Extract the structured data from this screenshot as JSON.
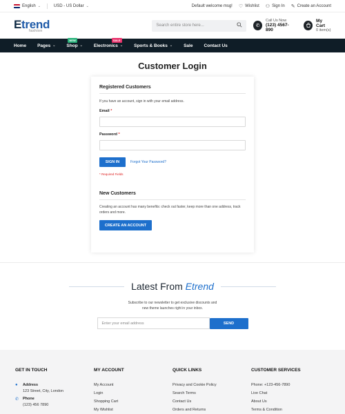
{
  "topbar": {
    "language": "English",
    "currency": "USD - US Dollar",
    "welcome": "Default welcome msg!",
    "wishlist": "Wishlist",
    "sign_in": "Sign In",
    "create_account": "Create an Account"
  },
  "header": {
    "logo_main_first": "E",
    "logo_main_rest": "trend",
    "logo_sub": "fashion",
    "search_placeholder": "Search entire store here...",
    "call_label": "Call Us Now",
    "call_number": "(123) 4567-890",
    "cart_label": "My Cart",
    "cart_count": "0 item(s)"
  },
  "nav": {
    "items": [
      {
        "label": "Home"
      },
      {
        "label": "Pages"
      },
      {
        "label": "Shop",
        "badge": "NEW"
      },
      {
        "label": "Electronics",
        "badge": "SALE"
      },
      {
        "label": "Sports & Books"
      },
      {
        "label": "Sale"
      },
      {
        "label": "Contact Us"
      }
    ]
  },
  "main": {
    "title": "Customer Login",
    "registered": {
      "heading": "Registered Customers",
      "intro": "If you have an account, sign in with your email address.",
      "email_label": "Email",
      "password_label": "Password",
      "required_mark": "*",
      "sign_in_button": "SIGN IN",
      "forgot_link": "Forgot Your Password?",
      "required_note": "* Required Fields"
    },
    "new_customers": {
      "heading": "New Customers",
      "description": "Creating an account has many benefits: check out faster, keep more than one address, track orders and more.",
      "create_button": "CREATE AN ACCOUNT"
    }
  },
  "newsletter": {
    "title_plain": "Latest From ",
    "title_accent": "Etrend",
    "subtitle_line1": "Subscribe to our newsletter to get exclusive discounts and",
    "subtitle_line2": "new theme launches right in your inbox.",
    "email_placeholder": "Enter your email address",
    "send_button": "SEND"
  },
  "footer": {
    "get_in_touch": {
      "heading": "GET IN TOUCH",
      "address_label": "Address",
      "address_value": "123 Street, City, London",
      "phone_label": "Phone",
      "phone_value": "(123) 456 7890"
    },
    "my_account": {
      "heading": "MY ACCOUNT",
      "links": [
        "My Account",
        "Login",
        "Shopping Cart",
        "My Wishlist"
      ]
    },
    "quick_links": {
      "heading": "QUICK LINKS",
      "links": [
        "Privacy and Cookie Policy",
        "Search Terms",
        "Contact Us",
        "Orders and Returns"
      ]
    },
    "customer_services": {
      "heading": "CUSTOMER SERVICES",
      "links": [
        "Phone: +123-456-7890",
        "Live Chat",
        "About Us",
        "Terms & Condition"
      ]
    }
  },
  "colors": {
    "brand_blue": "#1d6fcc",
    "nav_bg": "#0f1d27",
    "badge_new": "#2ab27b",
    "badge_sale": "#e8326b",
    "footer_bg": "#f4f4f5"
  },
  "icons": [
    "chevron-down-icon",
    "heart-icon",
    "user-icon",
    "pencil-icon",
    "search-icon",
    "phone-icon",
    "cart-icon",
    "location-icon"
  ]
}
